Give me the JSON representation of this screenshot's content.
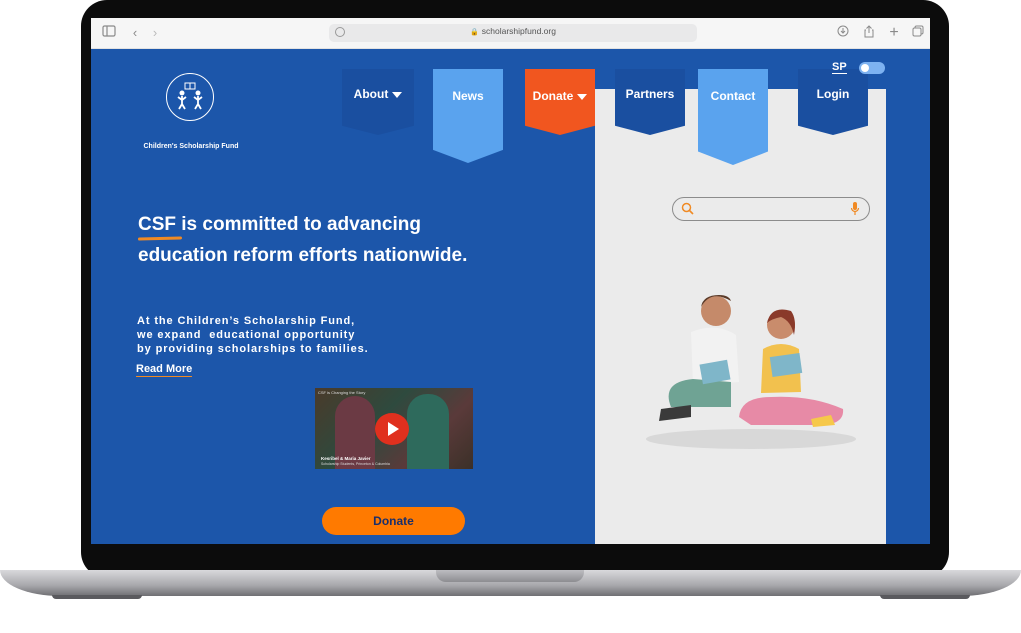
{
  "browser": {
    "url": "scholarshipfund.org",
    "icons": [
      "sidebar-icon",
      "back-icon",
      "forward-icon",
      "download-icon",
      "share-icon",
      "new-tab-icon",
      "tabs-icon"
    ]
  },
  "logo": {
    "name": "Children's Scholarship Fund"
  },
  "nav": {
    "about": "About",
    "news": "News",
    "donate": "Donate",
    "partners": "Partners",
    "contact": "Contact",
    "login": "Login"
  },
  "lang": "SP",
  "search": {
    "placeholder": ""
  },
  "hero": {
    "headline": "CSF is committed to advancing education reform efforts nationwide.",
    "sub_line1": "At the Children’s Scholarship Fund,",
    "sub_line2": "we expand  educational opportunity",
    "sub_line3": "by providing scholarships to families.",
    "read_more": "Read More"
  },
  "video": {
    "title": "CSF is Changing the Story",
    "caption_name": "Kesribel & Maria Javier",
    "caption_sub": "Scholarship Students, Princeton & Columbia"
  },
  "cta": {
    "donate": "Donate"
  },
  "colors": {
    "page_blue": "#1c56aa",
    "nav_light": "#5aa3ee",
    "accent_orange": "#f1561f",
    "button_orange": "#ff7a00",
    "panel_gray": "#ebebeb"
  }
}
